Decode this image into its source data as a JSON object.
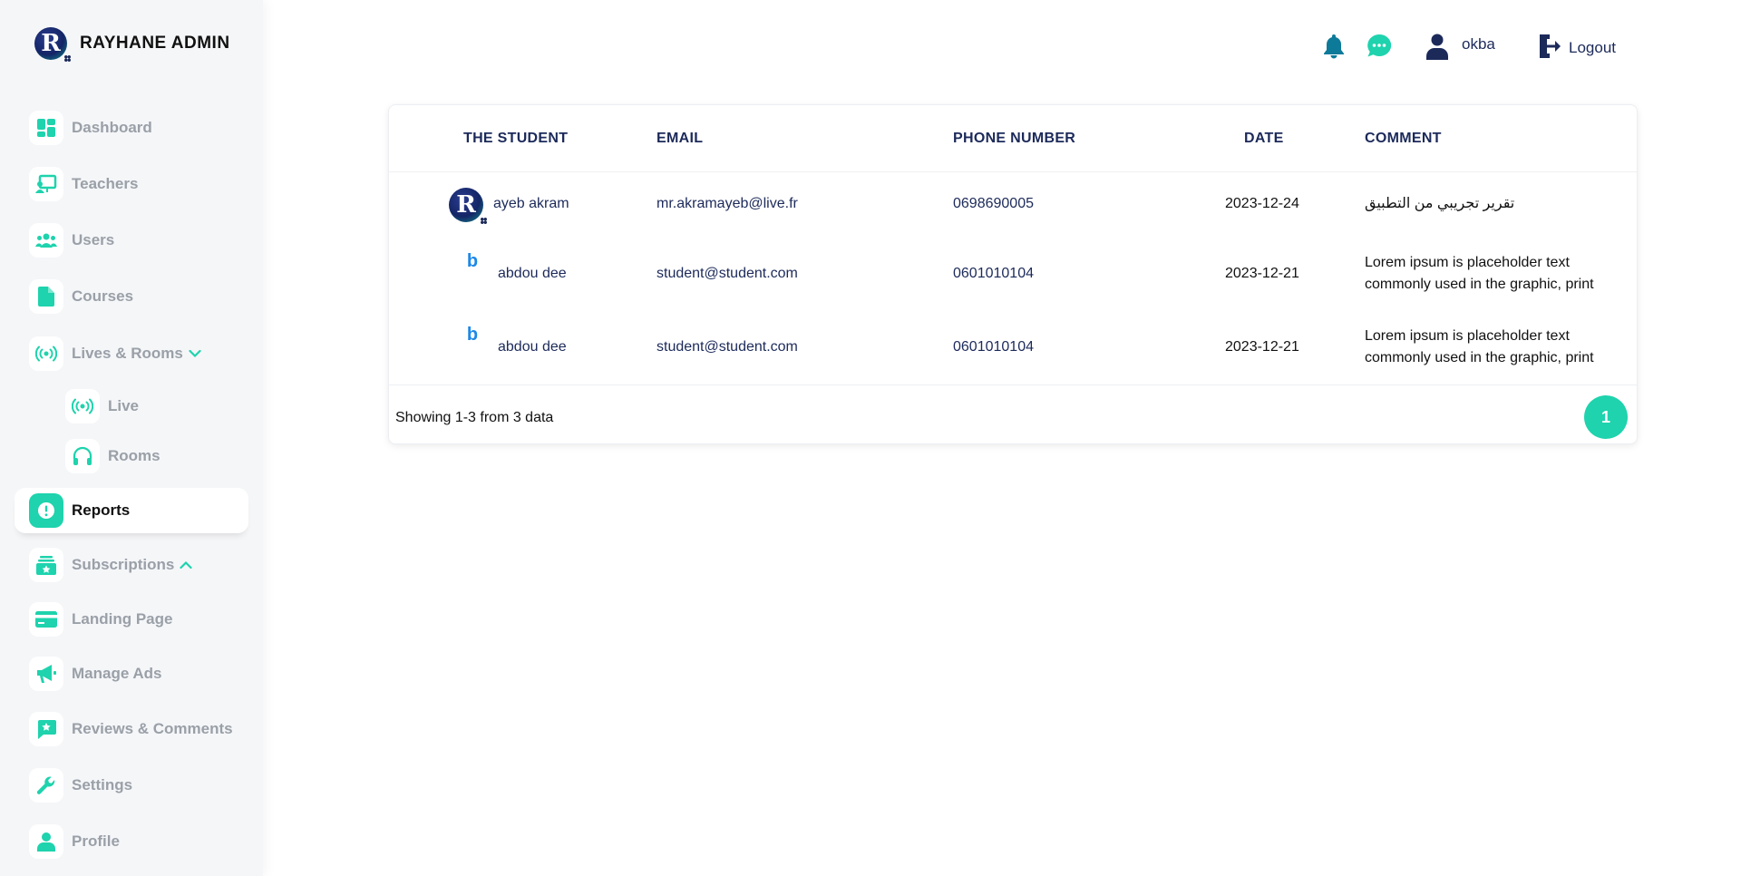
{
  "brand": {
    "initial": "R",
    "title": "RAYHANE ADMIN"
  },
  "sidebar": {
    "items": [
      {
        "label": "Dashboard"
      },
      {
        "label": "Teachers"
      },
      {
        "label": "Users"
      },
      {
        "label": "Courses"
      },
      {
        "label": "Lives & Rooms"
      },
      {
        "label": "Live"
      },
      {
        "label": "Rooms"
      },
      {
        "label": "Reports"
      },
      {
        "label": "Subscriptions"
      },
      {
        "label": "Landing Page"
      },
      {
        "label": "Manage Ads"
      },
      {
        "label": "Reviews & Comments"
      },
      {
        "label": "Settings"
      },
      {
        "label": "Profile"
      }
    ],
    "active": "Reports"
  },
  "header": {
    "user": "okba",
    "logout": "Logout"
  },
  "table": {
    "columns": [
      "THE STUDENT",
      "EMAIL",
      "PHONE NUMBER",
      "DATE",
      "COMMENT"
    ],
    "rows": [
      {
        "student": "ayeb akram",
        "avatar": "R",
        "email": "mr.akramayeb@live.fr",
        "phone": "0698690005",
        "date": "2023-12-24",
        "comment": "تقرير تجريبي من التطبيق"
      },
      {
        "student": "abdou dee",
        "avatar": "b",
        "email": "student@student.com",
        "phone": "0601010104",
        "date": "2023-12-21",
        "comment": "Lorem ipsum is placeholder text commonly used in the graphic, print"
      },
      {
        "student": "abdou dee",
        "avatar": "b",
        "email": "student@student.com",
        "phone": "0601010104",
        "date": "2023-12-21",
        "comment": "Lorem ipsum is placeholder text commonly used in the graphic, print"
      }
    ],
    "showing": "Showing 1-3 from 3 data",
    "current_page": "1"
  },
  "colors": {
    "accent": "#1ed3ad",
    "navy": "#1c2a5a",
    "muted": "#9aa0a8"
  }
}
